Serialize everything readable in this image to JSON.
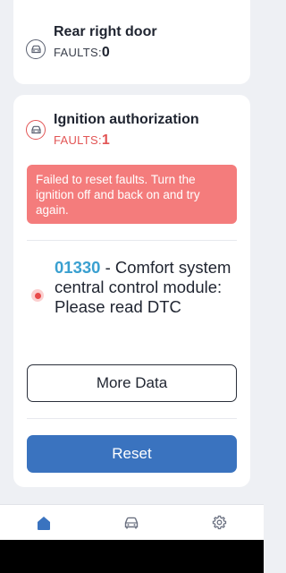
{
  "ecus": [
    {
      "name": "Rear right door",
      "faults_label": "FAULTS:",
      "faults_count": "0",
      "icon": "car-icon"
    },
    {
      "name": "Ignition authorization",
      "faults_label": "FAULTS:",
      "faults_count": "1",
      "icon": "car-icon"
    }
  ],
  "error": {
    "message": "Failed to reset faults. Turn the ignition off and back on and try again."
  },
  "dtc": {
    "code": "01330",
    "separator": " - ",
    "description": "Comfort system central control module: Please read DTC"
  },
  "buttons": {
    "more_data": "More Data",
    "reset": "Reset"
  },
  "nav": {
    "items": [
      {
        "icon": "home-icon",
        "active": true
      },
      {
        "icon": "car-icon",
        "active": false
      },
      {
        "icon": "gear-icon",
        "active": false
      }
    ]
  },
  "colors": {
    "accent": "#3a73bf",
    "error": "#e25555",
    "error_banner": "#f47c7c",
    "dtc_code": "#3aa0d0"
  }
}
